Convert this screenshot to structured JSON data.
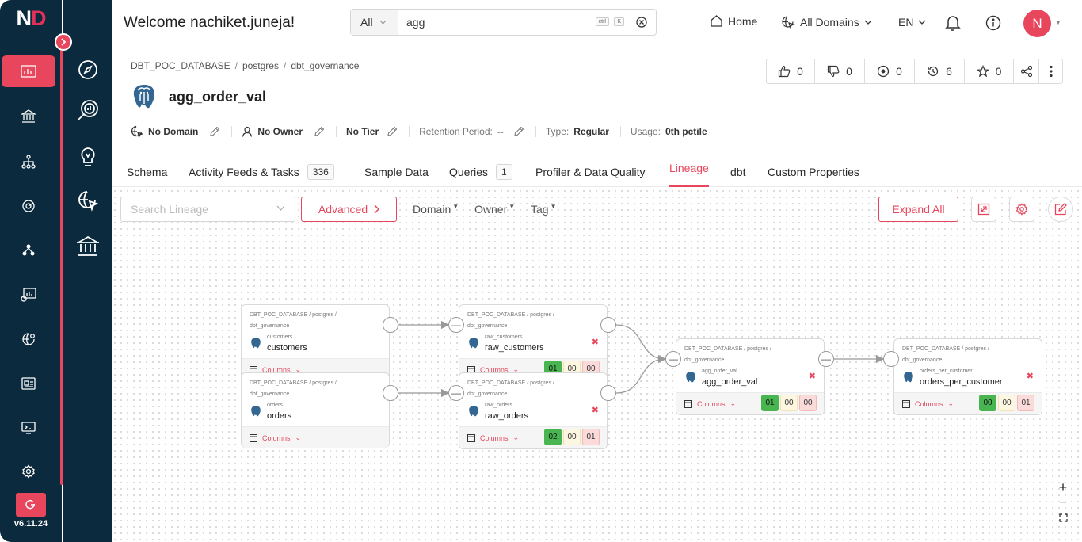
{
  "app": {
    "logo_n": "N",
    "logo_d": "D",
    "version": "v6.11.24"
  },
  "header": {
    "welcome": "Welcome nachiket.juneja!",
    "search_category": "All",
    "search_value": "agg",
    "kbd_ctrl": "ctrl",
    "kbd_k": "K",
    "home": "Home",
    "domains": "All Domains",
    "language": "EN",
    "avatar_initial": "N"
  },
  "entity": {
    "breadcrumb": [
      "DBT_POC_DATABASE",
      "postgres",
      "dbt_governance"
    ],
    "title": "agg_order_val",
    "stats": {
      "likes": "0",
      "dislikes": "0",
      "tasks": "0",
      "versions": "6",
      "stars": "0"
    },
    "meta": {
      "domain": "No Domain",
      "owner": "No Owner",
      "tier": "No Tier",
      "retention_label": "Retention Period:",
      "retention_value": "--",
      "type_label": "Type:",
      "type_value": "Regular",
      "usage_label": "Usage:",
      "usage_value": "0th pctile"
    }
  },
  "tabs": [
    {
      "label": "Schema"
    },
    {
      "label": "Activity Feeds & Tasks",
      "count": "336"
    },
    {
      "label": "Sample Data"
    },
    {
      "label": "Queries",
      "count": "1"
    },
    {
      "label": "Profiler & Data Quality"
    },
    {
      "label": "Lineage"
    },
    {
      "label": "dbt"
    },
    {
      "label": "Custom Properties"
    }
  ],
  "lineage": {
    "search_placeholder": "Search Lineage",
    "advanced": "Advanced",
    "filters": [
      "Domain",
      "Owner",
      "Tag"
    ],
    "expand_all": "Expand All",
    "columns_label": "Columns",
    "path_line1": "DBT_POC_DATABASE / postgres /",
    "path_line2": "dbt_governance",
    "nodes": [
      {
        "sub": "customers",
        "name": "customers"
      },
      {
        "sub": "orders",
        "name": "orders"
      },
      {
        "sub": "raw_customers",
        "name": "raw_customers",
        "badges": [
          "01",
          "00",
          "00"
        ]
      },
      {
        "sub": "raw_orders",
        "name": "raw_orders",
        "badges": [
          "02",
          "00",
          "01"
        ]
      },
      {
        "sub": "agg_order_val",
        "name": "agg_order_val",
        "badges": [
          "01",
          "00",
          "00"
        ]
      },
      {
        "sub": "orders_per_customer",
        "name": "orders_per_customer",
        "badges": [
          "00",
          "00",
          "01"
        ]
      }
    ],
    "zoom_in": "+",
    "zoom_out": "−"
  },
  "colors": {
    "accent": "#e8465d",
    "rail": "#0c2a3d",
    "success": "#48b550"
  }
}
